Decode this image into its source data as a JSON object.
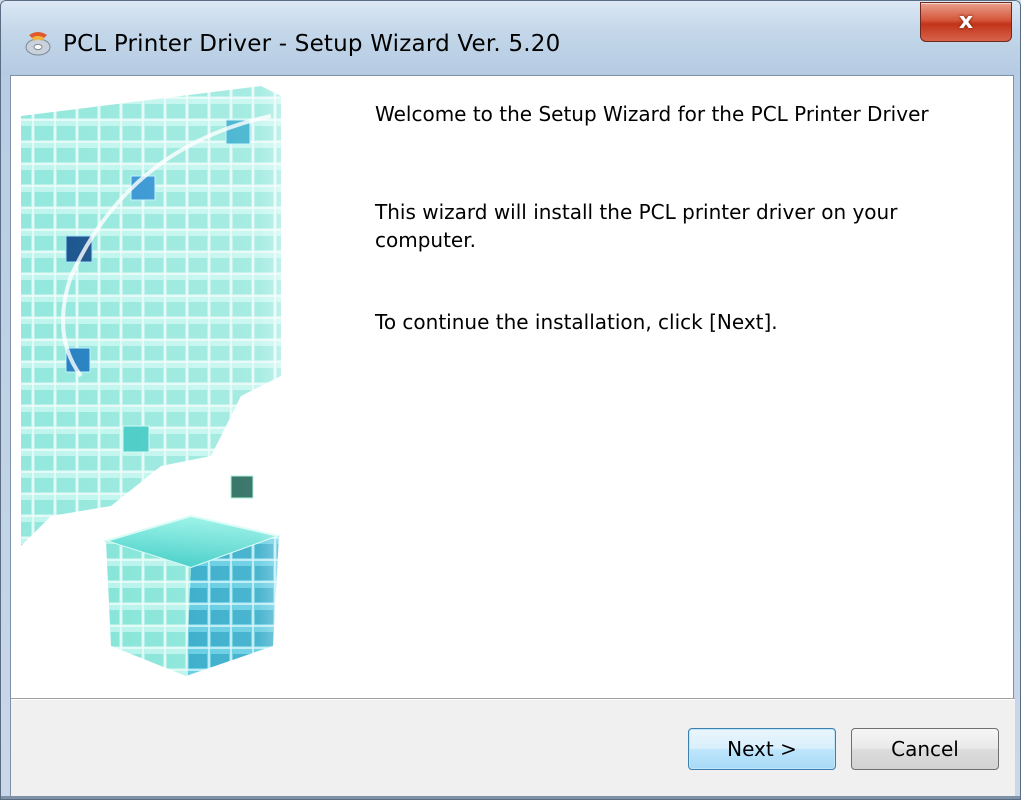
{
  "window": {
    "title": "PCL Printer Driver - Setup Wizard Ver. 5.20",
    "close_label": "x"
  },
  "content": {
    "welcome": "Welcome to the Setup Wizard for the PCL Printer Driver",
    "description": "This wizard will install the PCL printer driver on your computer.",
    "continue_text": "To continue the installation, click [Next]."
  },
  "buttons": {
    "next_label": "Next >",
    "cancel_label": "Cancel"
  },
  "icons": {
    "title_icon": "setup-disc-icon",
    "banner_art": "cube-graphic"
  },
  "colors": {
    "accent_teal": "#2ec8c0",
    "close_red": "#c2341a",
    "footer_bg": "#f0f0f0"
  }
}
